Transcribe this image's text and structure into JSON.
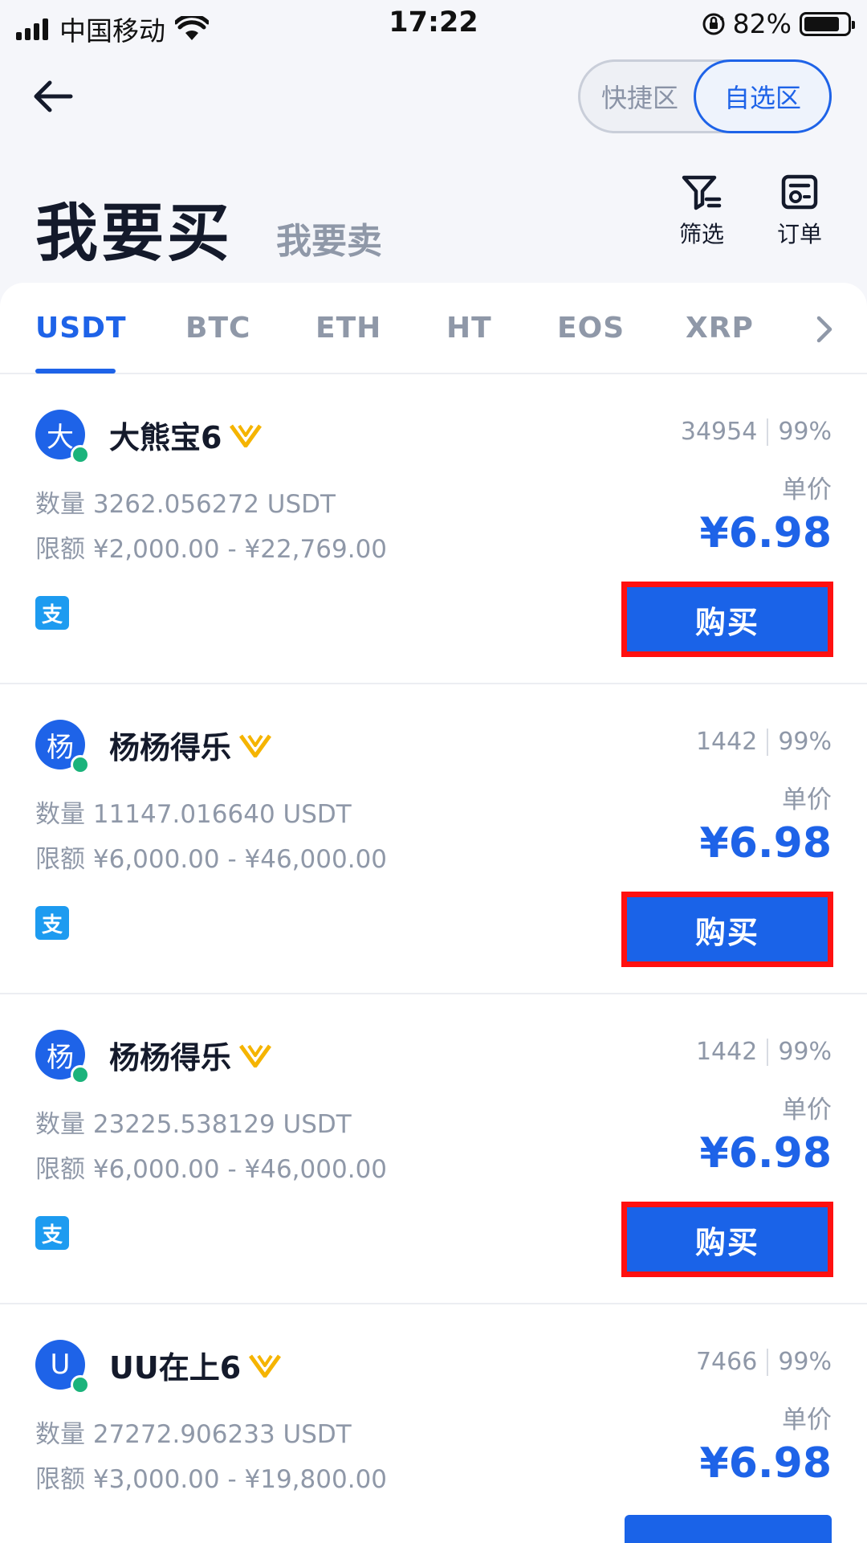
{
  "status_bar": {
    "carrier": "中国移动",
    "time": "17:22",
    "battery": "82%",
    "battery_level": 0.82
  },
  "segment": {
    "quick": "快捷区",
    "favorites": "自选区",
    "selected": "自选区"
  },
  "header": {
    "buy": "我要买",
    "sell": "我要卖",
    "filter": "筛选",
    "orders": "订单"
  },
  "tabs": [
    "USDT",
    "BTC",
    "ETH",
    "HT",
    "EOS",
    "XRP"
  ],
  "active_tab": "USDT",
  "listings": [
    {
      "avatar": "大",
      "name": "大熊宝6",
      "orders": "34954",
      "rate": "99%",
      "quantity": "数量 3262.056272 USDT",
      "limit": "限额 ¥2,000.00 - ¥22,769.00",
      "price_label": "单价",
      "price": "¥6.98",
      "pay": "支",
      "buy": "购买"
    },
    {
      "avatar": "杨",
      "name": "杨杨得乐",
      "orders": "1442",
      "rate": "99%",
      "quantity": "数量 11147.016640 USDT",
      "limit": "限额 ¥6,000.00 - ¥46,000.00",
      "price_label": "单价",
      "price": "¥6.98",
      "pay": "支",
      "buy": "购买"
    },
    {
      "avatar": "杨",
      "name": "杨杨得乐",
      "orders": "1442",
      "rate": "99%",
      "quantity": "数量 23225.538129 USDT",
      "limit": "限额 ¥6,000.00 - ¥46,000.00",
      "price_label": "单价",
      "price": "¥6.98",
      "pay": "支",
      "buy": "购买"
    },
    {
      "avatar": "U",
      "name": "UU在上6",
      "orders": "7466",
      "rate": "99%",
      "quantity": "数量 27272.906233 USDT",
      "limit": "限额 ¥3,000.00 - ¥19,800.00",
      "price_label": "单价",
      "price": "¥6.98"
    }
  ],
  "colors": {
    "accent": "#1e63e8",
    "highlight": "#ff1010",
    "online": "#1bb37b",
    "badge": "#f5b400"
  }
}
